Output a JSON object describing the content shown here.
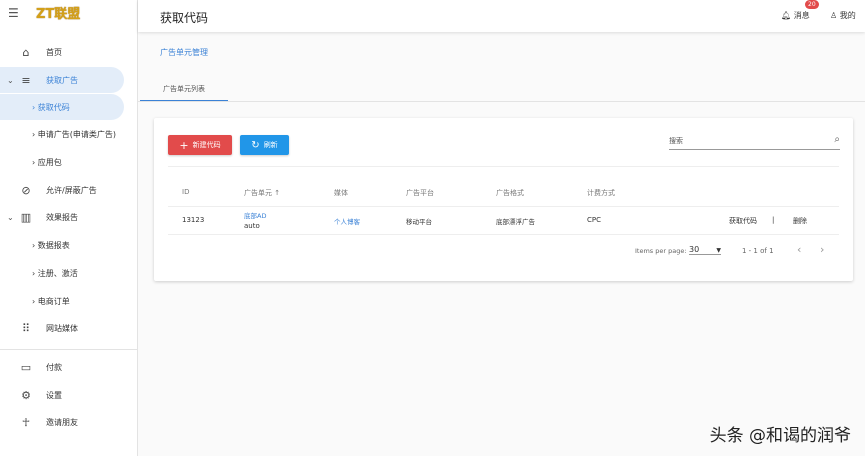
{
  "app": {
    "logo": "ZT联盟",
    "page_title": "获取代码"
  },
  "header": {
    "messages_label": "消息",
    "messages_badge": "20",
    "profile_label": "我的"
  },
  "sidebar": {
    "items": [
      {
        "label": "首页",
        "icon": "home-icon"
      },
      {
        "label": "获取广告",
        "icon": "sort-icon"
      },
      {
        "label": "获取代码"
      },
      {
        "label": "申请广告(申请类广告)"
      },
      {
        "label": "应用包"
      },
      {
        "label": "允许/屏蔽广告",
        "icon": "block-icon"
      },
      {
        "label": "效果报告",
        "icon": "bar-chart-icon"
      },
      {
        "label": "数据报表"
      },
      {
        "label": "注册、激活"
      },
      {
        "label": "电商订单"
      },
      {
        "label": "网站媒体",
        "icon": "apps-icon"
      },
      {
        "label": "付款",
        "icon": "credit-card-icon"
      },
      {
        "label": "设置",
        "icon": "gear-icon"
      },
      {
        "label": "邀请朋友",
        "icon": "person-icon"
      }
    ]
  },
  "breadcrumb": "广告单元管理",
  "tabs": [
    {
      "label": "广告单元列表",
      "active": true
    }
  ],
  "toolbar": {
    "new_label": "新建代码",
    "refresh_label": "刷新",
    "search_placeholder": "搜索",
    "new_color": "#e24b4b",
    "refresh_color": "#2196e8"
  },
  "table": {
    "headers": [
      "ID",
      "广告单元 ↑",
      "媒体",
      "广告平台",
      "广告格式",
      "计费方式"
    ],
    "rows": [
      {
        "id": "13123",
        "unit_name": "底部AD",
        "unit_sub": "auto",
        "media": "个人博客",
        "platform": "移动平台",
        "format": "底部漂浮广告",
        "billing": "CPC",
        "action_get": "获取代码",
        "action_sep": "|",
        "action_delete": "删除"
      }
    ]
  },
  "pagination": {
    "items_per_page_label": "Items per page:",
    "items_per_page": "30",
    "range": "1 - 1 of 1"
  },
  "watermark": "头条 @和谒的润爷"
}
